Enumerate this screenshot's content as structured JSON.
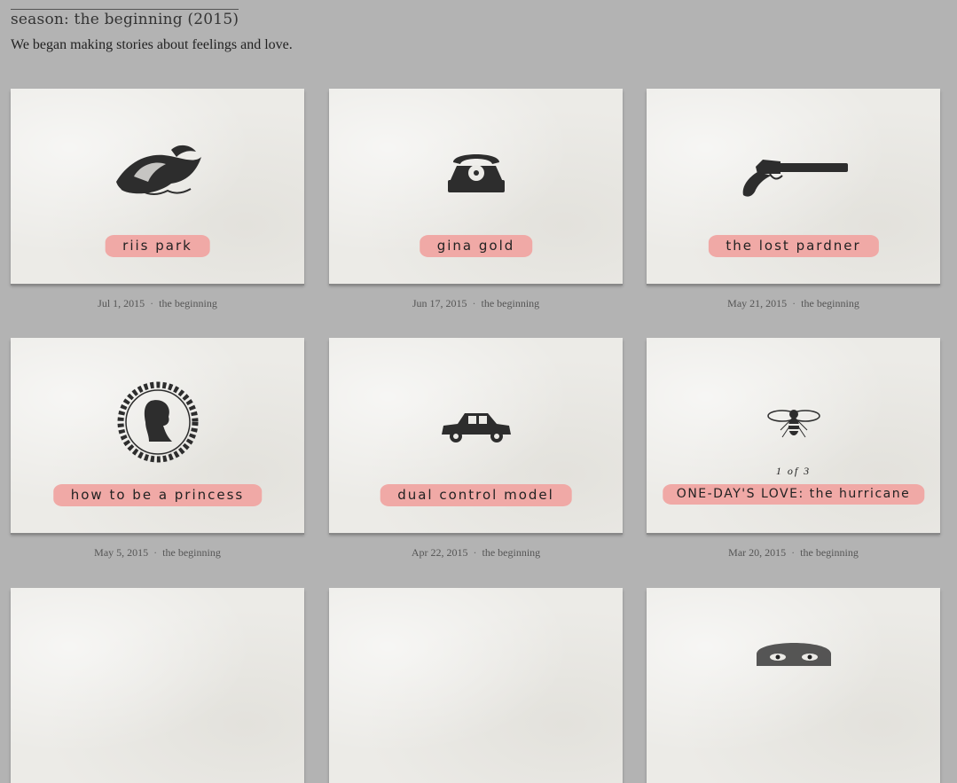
{
  "season": {
    "title": "season: the beginning (2015)",
    "intro": "We began making stories about feelings and love."
  },
  "episodes": [
    {
      "title": "riis park",
      "date": "Jul 1, 2015",
      "category": "the beginning",
      "icon": "wave-icon"
    },
    {
      "title": "gina gold",
      "date": "Jun 17, 2015",
      "category": "the beginning",
      "icon": "telephone-icon"
    },
    {
      "title": "the lost pardner",
      "date": "May 21, 2015",
      "category": "the beginning",
      "icon": "pistol-icon"
    },
    {
      "title": "how to be a princess",
      "date": "May 5, 2015",
      "category": "the beginning",
      "icon": "silhouette-wreath-icon"
    },
    {
      "title": "dual control model",
      "date": "Apr 22, 2015",
      "category": "the beginning",
      "icon": "car-icon"
    },
    {
      "title": "ONE-DAY'S LOVE: the hurricane",
      "part": "1 of 3",
      "date": "Mar 20, 2015",
      "category": "the beginning",
      "icon": "bee-icon"
    }
  ],
  "row3": [
    {
      "icon": "blank"
    },
    {
      "icon": "blank"
    },
    {
      "icon": "face-icon"
    }
  ],
  "separator": "·"
}
